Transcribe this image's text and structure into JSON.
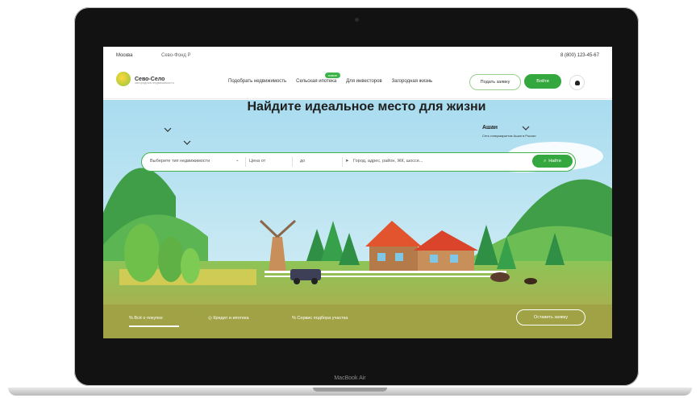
{
  "device": {
    "label": "MacBook Air"
  },
  "topbar": {
    "city": "Москва",
    "region": "Сево-Фонд Р",
    "phone": "8 (800) 123-45-67"
  },
  "header": {
    "logo_name": "Сево-Село",
    "logo_sub": "загородная недвижимость",
    "menu": [
      "Подобрать недвижимость",
      "Сельская ипотека",
      "Для инвесторов",
      "Загородная жизнь"
    ],
    "badge": "новое",
    "cta_outline": "Подать заявку",
    "cta_green": "Войти"
  },
  "hero": {
    "title": "Найдите идеальное место для жизни",
    "partner_name": "Ашан",
    "partner_sub": "Сеть гипермаркетов Ашан в России",
    "search": {
      "type_placeholder": "Выберите тип недвижимости",
      "price_from": "Цена от",
      "price_to": "до",
      "location_placeholder": "Город, адрес, район, ЖК, шоссе...",
      "button": "Найти"
    },
    "tabs": [
      "Всё о покупке",
      "Кредит и ипотека",
      "Сервис подбора участка"
    ],
    "cta": "Оставить заявку"
  },
  "colors": {
    "accent": "#34a73f",
    "sky": "#bde3f2",
    "hill": "#4aa64f"
  }
}
